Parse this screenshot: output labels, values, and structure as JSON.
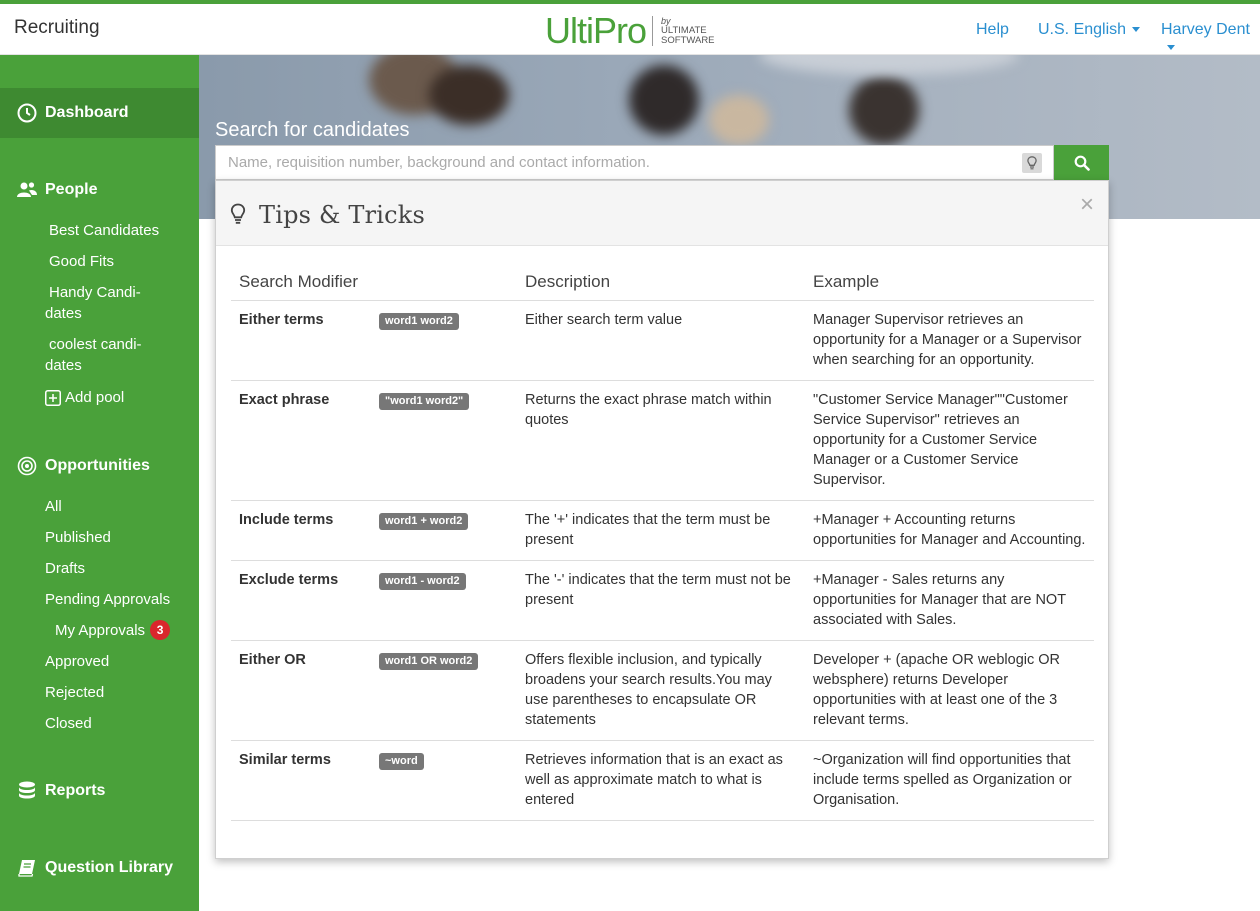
{
  "app": {
    "title": "Recruiting"
  },
  "logo": {
    "main": "UltiPro",
    "by": "by",
    "line1": "ULTIMATE",
    "line2": "SOFTWARE"
  },
  "header": {
    "help": "Help",
    "language": "U.S. English",
    "user": "Harvey Dent"
  },
  "sidebar": {
    "dashboard": "Dashboard",
    "people": "People",
    "pools": [
      {
        "label": "Best Candidates"
      },
      {
        "label": "Good Fits"
      },
      {
        "label": "Handy Candi-\ndates"
      },
      {
        "label": "coolest candi-\ndates"
      }
    ],
    "add_pool": "Add pool",
    "opportunities": "Opportunities",
    "opp_items": {
      "all": "All",
      "published": "Published",
      "drafts": "Drafts",
      "pending": "Pending Approvals",
      "my_approvals": "My Approvals",
      "my_approvals_count": "3",
      "approved": "Approved",
      "rejected": "Rejected",
      "closed": "Closed"
    },
    "reports": "Reports",
    "question_library": "Question Library"
  },
  "search": {
    "title": "Search for candidates",
    "placeholder": "Name, requisition number, background and contact information."
  },
  "tips": {
    "title": "Tips & Tricks",
    "close": "×",
    "columns": [
      "Search Modifier",
      "Description",
      "Example"
    ],
    "rows": [
      {
        "modifier": "Either terms",
        "code": "word1 word2",
        "description": "Either search term value",
        "example": "Manager Supervisor retrieves an opportunity for a Manager or a Supervisor when searching for an opportunity."
      },
      {
        "modifier": "Exact phrase",
        "code": "\"word1 word2\"",
        "description": "Returns the exact phrase match within quotes",
        "example": "\"Customer Service Manager\"\"Customer Service Supervisor\" retrieves an opportunity for a Customer Service Manager or a Customer Service Supervisor."
      },
      {
        "modifier": "Include terms",
        "code": "word1 + word2",
        "description": "The '+' indicates that the term must be present",
        "example": "+Manager + Accounting returns opportunities for Manager and Accounting."
      },
      {
        "modifier": "Exclude terms",
        "code": "word1 - word2",
        "description": "The '-' indicates that the term must not be present",
        "example": "+Manager - Sales returns any opportunities for Manager that are NOT associated with Sales."
      },
      {
        "modifier": "Either OR",
        "code": "word1 OR word2",
        "description": "Offers flexible inclusion, and typically broadens your search results.You may use parentheses to encapsulate OR statements",
        "example": "Developer + (apache OR weblogic OR websphere) returns Developer opportunities with at least one of the 3 relevant terms."
      },
      {
        "modifier": "Similar terms",
        "code": "~word",
        "description": "Retrieves information that is an exact as well as approximate match to what is entered",
        "example": "~Organization will find opportunities that include terms spelled as Organization or Organisation."
      }
    ]
  },
  "colors": {
    "brand_green": "#4aa13a",
    "active_green": "#3e8a31",
    "link_blue": "#2a8fd0",
    "badge_red": "#d9262c"
  }
}
